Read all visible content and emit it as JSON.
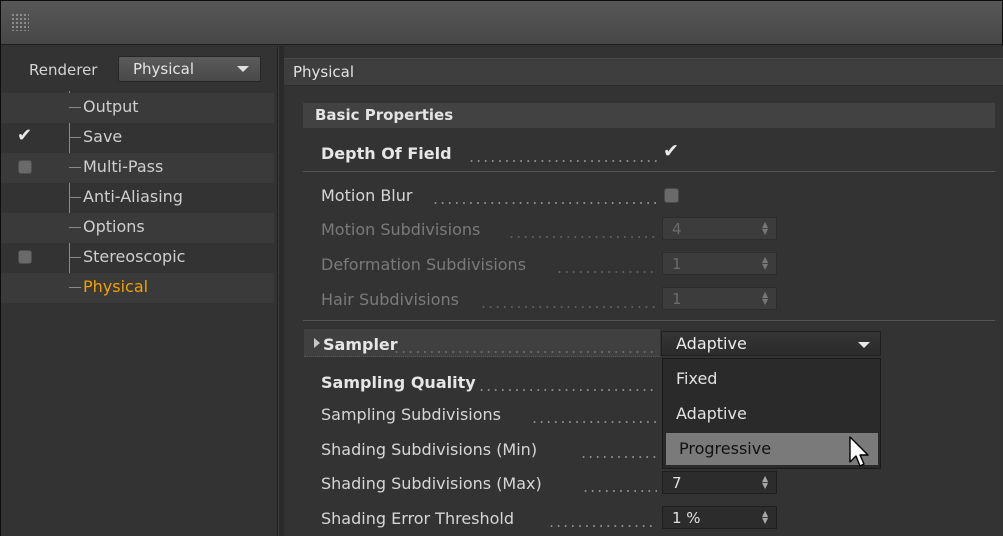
{
  "left_panel": {
    "renderer_label": "Renderer",
    "renderer_value": "Physical",
    "tree": [
      {
        "label": "Output",
        "checkbox": "none"
      },
      {
        "label": "Save",
        "checkbox": "checked"
      },
      {
        "label": "Multi-Pass",
        "checkbox": "unchecked"
      },
      {
        "label": "Anti-Aliasing",
        "checkbox": "none"
      },
      {
        "label": "Options",
        "checkbox": "none"
      },
      {
        "label": "Stereoscopic",
        "checkbox": "unchecked"
      },
      {
        "label": "Physical",
        "checkbox": "none",
        "selected": true
      }
    ]
  },
  "right_panel": {
    "header": "Physical",
    "section": "Basic Properties",
    "depth_of_field": {
      "label": "Depth Of Field",
      "checked": true
    },
    "motion_blur": {
      "label": "Motion Blur",
      "checked": false
    },
    "motion_subdivisions": {
      "label": "Motion Subdivisions",
      "value": "4"
    },
    "deformation_subdivisions": {
      "label": "Deformation Subdivisions",
      "value": "1"
    },
    "hair_subdivisions": {
      "label": "Hair Subdivisions",
      "value": "1"
    },
    "sampler": {
      "label": "Sampler",
      "value": "Adaptive",
      "options": [
        "Fixed",
        "Adaptive",
        "Progressive"
      ],
      "hovered": "Progressive"
    },
    "sampling_quality": {
      "label": "Sampling Quality"
    },
    "sampling_subdivisions": {
      "label": "Sampling Subdivisions"
    },
    "shading_subdivisions_min": {
      "label": "Shading Subdivisions (Min)"
    },
    "shading_subdivisions_max": {
      "label": "Shading Subdivisions (Max)",
      "value": "7"
    },
    "shading_error_threshold": {
      "label": "Shading Error Threshold",
      "value": "1 %"
    }
  },
  "colors": {
    "accent": "#f0a000",
    "panel_bg": "#333333"
  },
  "icons": [
    "grip-icon",
    "checkmark-icon",
    "dropdown-arrow-icon",
    "spinner-arrows-icon",
    "mouse-cursor-icon",
    "expand-triangle-icon"
  ]
}
